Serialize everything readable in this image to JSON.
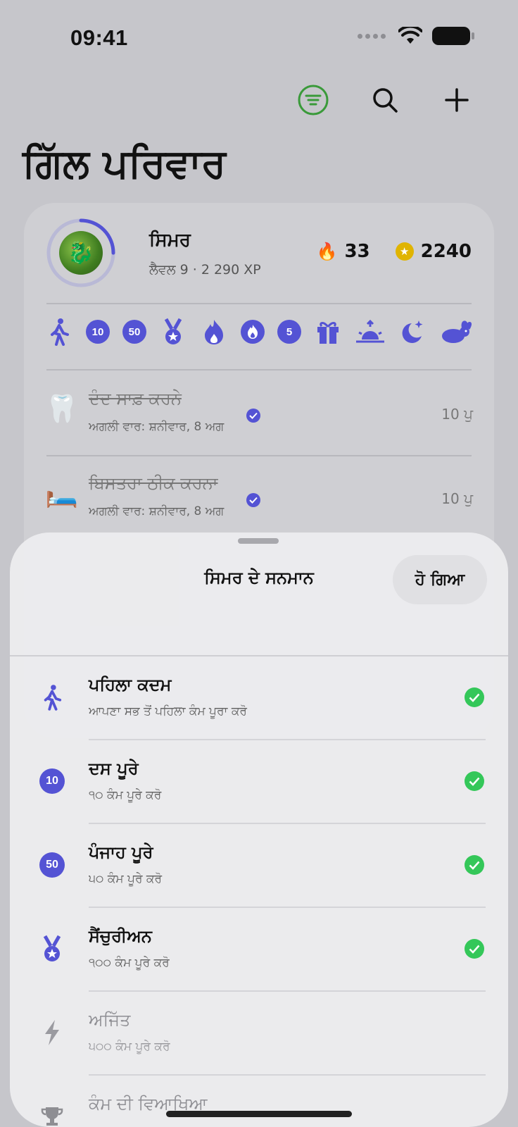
{
  "status": {
    "time": "09:41"
  },
  "page": {
    "title": "ਗਿੱਲ ਪਰਿਵਾਰ"
  },
  "profile": {
    "name": "ਸਿਮਰ",
    "level_text": "ਲੈਵਲ 9 · 2 290 XP",
    "streak": "33",
    "coins": "2240",
    "level_progress": 0.25
  },
  "badges": [
    {
      "icon": "walking-figure-icon"
    },
    {
      "label": "10"
    },
    {
      "label": "50"
    },
    {
      "icon": "medal-icon"
    },
    {
      "icon": "flame-icon"
    },
    {
      "icon": "flame-badge-icon"
    },
    {
      "label": "5"
    },
    {
      "icon": "gift-icon"
    },
    {
      "icon": "sunrise-icon"
    },
    {
      "icon": "moon-stars-icon"
    },
    {
      "icon": "rabbit-icon"
    }
  ],
  "tasks": [
    {
      "emoji": "🦷",
      "title": "ਦੰਦ ਸਾਫ਼ ਕਰਨੇ",
      "next": "ਅਗਲੀ ਵਾਰ: ਸ਼ਨੀਵਾਰ, 8 ਅਗ",
      "points": "10 ਪੁ"
    },
    {
      "emoji": "🛏️",
      "title": "ਬਿਸਤਰਾ ਠੀਕ ਕਰਨਾ",
      "next": "ਅਗਲੀ ਵਾਰ: ਸ਼ਨੀਵਾਰ, 8 ਅਗ",
      "points": "10 ਪੁ"
    }
  ],
  "sheet": {
    "title": "ਸਿਮਰ ਦੇ ਸਨਮਾਨ",
    "done_label": "ਹੋ ਗਿਆ",
    "achievements": [
      {
        "title": "ਪਹਿਲਾ ਕਦਮ",
        "desc": "ਆਪਣਾ ਸਭ ਤੋਂ ਪਹਿਲਾ ਕੰਮ ਪੂਰਾ ਕਰੋ",
        "icon": "walking-figure-icon",
        "earned": true
      },
      {
        "title": "ਦਸ ਪੂਰੇ",
        "desc": "੧੦ ਕੰਮ ਪੂਰੇ ਕਰੋ",
        "badge": "10",
        "earned": true
      },
      {
        "title": "ਪੰਜਾਹ ਪੂਰੇ",
        "desc": "੫੦ ਕੰਮ ਪੂਰੇ ਕਰੋ",
        "badge": "50",
        "earned": true
      },
      {
        "title": "ਸੈਂਚੁਰੀਅਨ",
        "desc": "੧੦੦ ਕੰਮ ਪੂਰੇ ਕਰੋ",
        "icon": "medal-icon",
        "earned": true
      },
      {
        "title": "ਅਜਿੱਤ",
        "desc": "੫੦੦ ਕੰਮ ਪੂਰੇ ਕਰੋ",
        "icon": "lightning-icon",
        "earned": false
      },
      {
        "title": "ਕੰਮ ਦੀ ਵਿਆਖਿਆ",
        "desc": "",
        "icon": "trophy-icon",
        "earned": false
      }
    ]
  },
  "colors": {
    "accent": "#5453d4",
    "check": "#34c759",
    "filter_ring": "#3a9a3a"
  }
}
